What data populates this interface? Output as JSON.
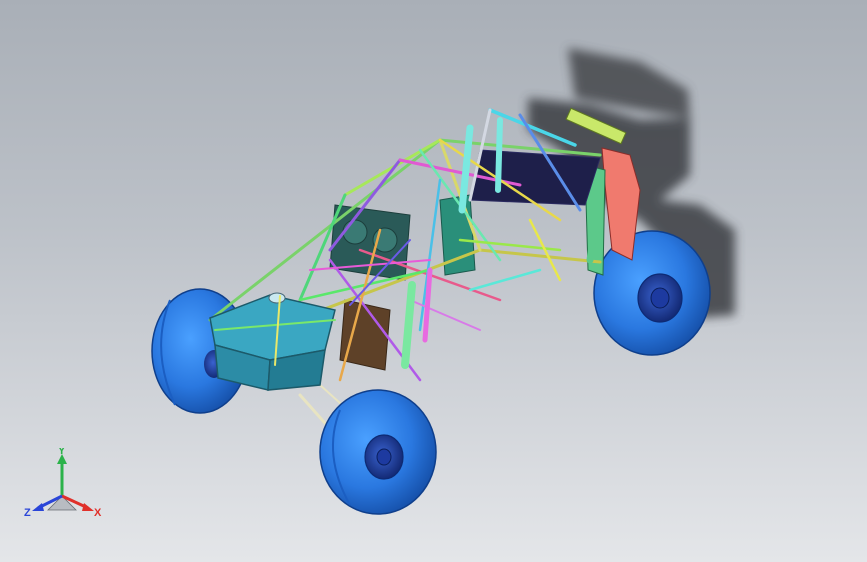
{
  "viewport": {
    "background_top": "#a9afb7",
    "background_bottom": "#e4e6e9"
  },
  "model": {
    "tire_color": "#2f7fe6",
    "tire_dark": "#1d5fc0",
    "hub_color": "#1b3fa8",
    "tank_color": "#3aa7c2",
    "shadow_color": "#4a4d52"
  },
  "triad": {
    "x_label": "X",
    "y_label": "Y",
    "z_label": "Z",
    "x_color": "#e0302a",
    "y_color": "#2bb24a",
    "z_color": "#2a45d8"
  }
}
